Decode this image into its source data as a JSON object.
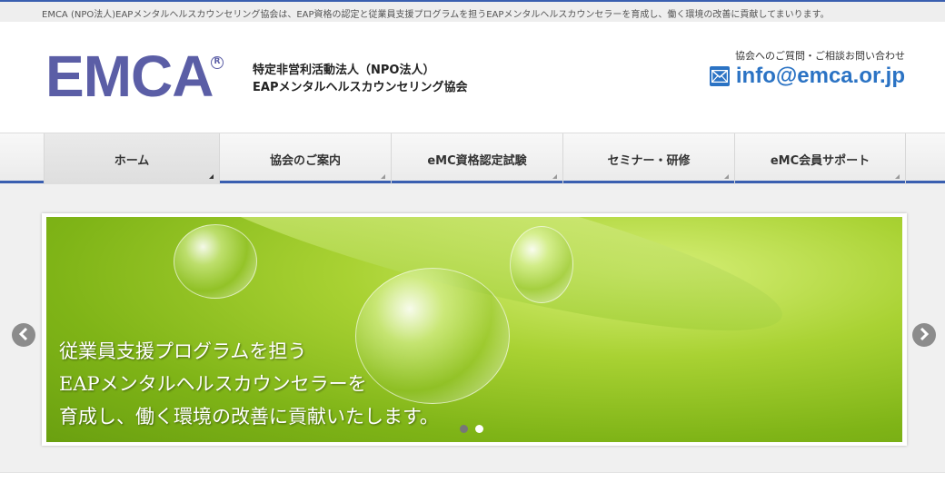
{
  "topbar": {
    "tagline": "EMCA (NPO法人)EAPメンタルヘルスカウンセリング協会は、EAP資格の認定と従業員支援プログラムを担うEAPメンタルヘルスカウンセラーを育成し、働く環境の改善に貢献してまいります。"
  },
  "header": {
    "logo_text": "EMCA",
    "logo_reg": "R",
    "org_line1": "特定非営利活動法人（NPO法人）",
    "org_line2": "EAPメンタルヘルスカウンセリング協会",
    "contact_label": "協会へのご質問・ご相談お問い合わせ",
    "email": "info@emca.or.jp",
    "email_icon": "mail-icon"
  },
  "nav": {
    "items": [
      {
        "label": "ホーム",
        "active": true
      },
      {
        "label": "協会のご案内"
      },
      {
        "label": "eMC資格認定試験"
      },
      {
        "label": "セミナー・研修"
      },
      {
        "label": "eMC会員サポート"
      }
    ]
  },
  "slider": {
    "caption_line1": "従業員支援プログラムを担う",
    "caption_line2": "EAPメンタルヘルスカウンセラーを",
    "caption_line3": "育成し、働く環境の改善に貢献いたします。",
    "current_slide": 1,
    "slide_count": 2,
    "prev_icon": "chevron-left-icon",
    "next_icon": "chevron-right-icon"
  },
  "colors": {
    "brand": "#5b5ea6",
    "accent_blue": "#2b73c4",
    "nav_border": "#3a5fb0"
  }
}
